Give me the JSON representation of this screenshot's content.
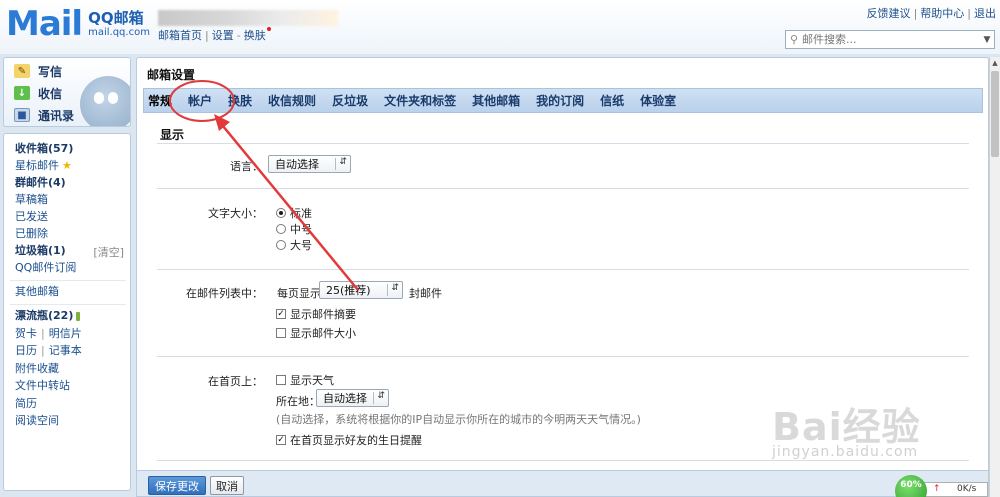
{
  "header": {
    "logo_text": "Mail",
    "logo_title": "QQ邮箱",
    "logo_domain": "mail.qq.com",
    "links": [
      "邮箱首页",
      "设置",
      "换肤"
    ],
    "right_links": [
      "反馈建议",
      "帮助中心",
      "退出"
    ],
    "search_placeholder": "邮件搜索..."
  },
  "sidebar": {
    "compose": [
      "写信",
      "收信",
      "通讯录"
    ],
    "folders": {
      "inbox": "收件箱(57)",
      "starred": "星标邮件",
      "group": "群邮件(4)",
      "drafts": "草稿箱",
      "sent": "已发送",
      "deleted": "已删除",
      "spam": "垃圾箱(1)",
      "spam_clear": "[清空]",
      "subscription": "QQ邮件订阅",
      "other_mail": "其他邮箱",
      "drift": "漂流瓶(22)",
      "card": "贺卡",
      "postcard": "明信片",
      "calendar": "日历",
      "notes": "记事本",
      "attachments": "附件收藏",
      "file_transfer": "文件中转站",
      "resume": "简历",
      "reading": "阅读空间"
    }
  },
  "main": {
    "title": "邮箱设置",
    "tabs": [
      "常规",
      "帐户",
      "换肤",
      "收信规则",
      "反垃圾",
      "文件夹和标签",
      "其他邮箱",
      "我的订阅",
      "信纸",
      "体验室"
    ],
    "section_title": "显示",
    "language": {
      "label": "语言：",
      "value": "自动选择"
    },
    "font_size": {
      "label": "文字大小：",
      "options": [
        "标准",
        "中号",
        "大号"
      ]
    },
    "mail_list": {
      "label": "在邮件列表中：",
      "per_page_prefix": "每页显示",
      "per_page_value": "25(推荐)",
      "per_page_suffix": "封邮件",
      "show_summary": "显示邮件摘要",
      "show_size": "显示邮件大小"
    },
    "homepage": {
      "label": "在首页上：",
      "show_weather": "显示天气",
      "location_label": "所在地：",
      "location_value": "自动选择",
      "location_note": "(自动选择，系统将根据你的IP自动显示你所在的城市的今明两天天气情况。)",
      "birthday": "在首页显示好友的生日提醒"
    },
    "buttons": {
      "save": "保存更改",
      "cancel": "取消"
    }
  },
  "watermark": {
    "main": "Bai经验",
    "sub": "jingyan.baidu.com"
  },
  "speed_widget": {
    "percent": "60%",
    "rate": "0K/s"
  }
}
